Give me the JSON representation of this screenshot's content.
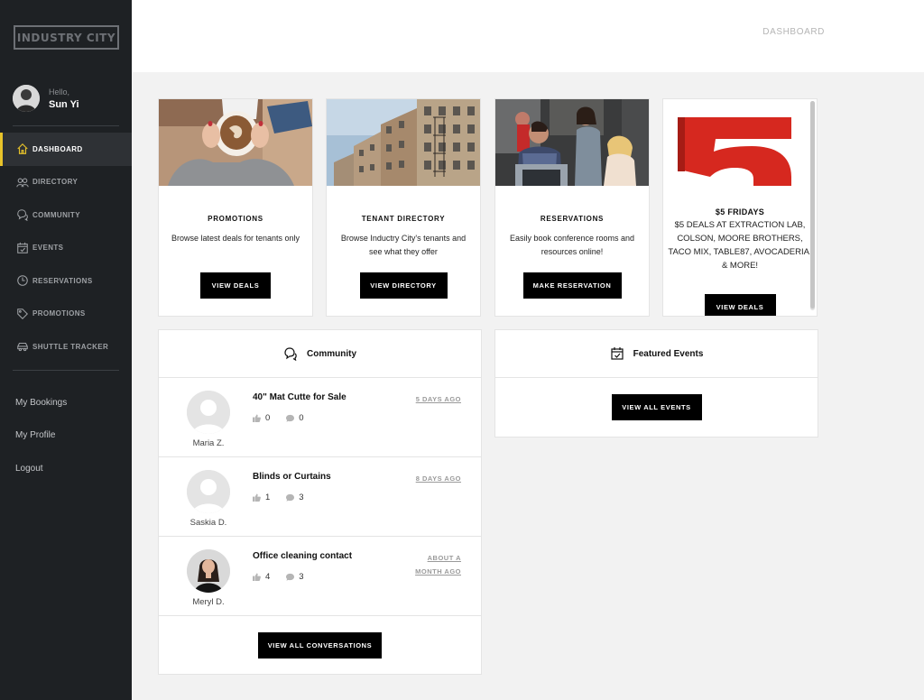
{
  "brand": {
    "logo_text": "INDUSTRY CITY",
    "accent_color": "#e8c32a"
  },
  "user": {
    "greeting": "Hello,",
    "name": "Sun Yi"
  },
  "nav": [
    {
      "label": "DASHBOARD",
      "icon": "home-icon",
      "active": true
    },
    {
      "label": "DIRECTORY",
      "icon": "people-icon"
    },
    {
      "label": "COMMUNITY",
      "icon": "chat-bubbles-icon"
    },
    {
      "label": "EVENTS",
      "icon": "calendar-check-icon"
    },
    {
      "label": "RESERVATIONS",
      "icon": "clock-icon"
    },
    {
      "label": "PROMOTIONS",
      "icon": "tag-icon"
    },
    {
      "label": "SHUTTLE TRACKER",
      "icon": "car-icon"
    }
  ],
  "links": [
    {
      "label": "My Bookings"
    },
    {
      "label": "My Profile"
    },
    {
      "label": "Logout"
    }
  ],
  "header": {
    "title": "DASHBOARD"
  },
  "cards": [
    {
      "title": "PROMOTIONS",
      "desc": "Browse latest deals for tenants only",
      "button": "VIEW DEALS"
    },
    {
      "title": "TENANT DIRECTORY",
      "desc": "Browse Inductry City's tenants and see what they offer",
      "button": "VIEW DIRECTORY"
    },
    {
      "title": "RESERVATIONS",
      "desc": "Easily book conference rooms and resources online!",
      "button": "MAKE RESERVATION"
    },
    {
      "title": "$5 FRIDAYS",
      "desc": "$5 deals at Extraction Lab, Colson, Moore Brothers, Taco Mix, Table87, Avocaderia, & more!",
      "button": "VIEW DEALS"
    }
  ],
  "community": {
    "title": "Community",
    "posts": [
      {
        "title": "40\" Mat Cutte for Sale",
        "date": "5 DAYS AGO",
        "likes": "0",
        "comments": "0",
        "author": "Maria Z."
      },
      {
        "title": "Blinds or Curtains",
        "date": "8 DAYS AGO",
        "likes": "1",
        "comments": "3",
        "author": "Saskia D."
      },
      {
        "title": "Office cleaning contact",
        "date": "ABOUT A MONTH AGO",
        "likes": "4",
        "comments": "3",
        "author": "Meryl D."
      }
    ],
    "button": "VIEW ALL CONVERSATIONS"
  },
  "events": {
    "title": "Featured Events",
    "button": "VIEW ALL EVENTS"
  }
}
